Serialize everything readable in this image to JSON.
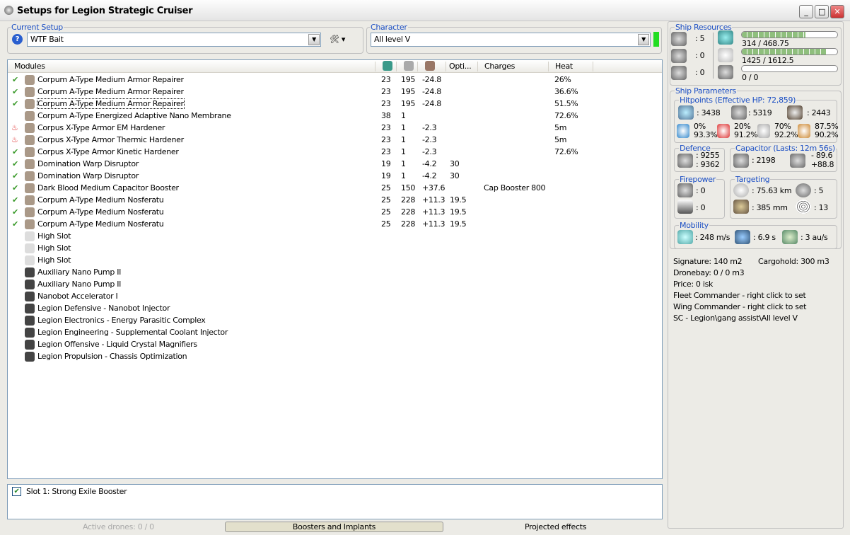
{
  "window": {
    "title": "Setups for Legion Strategic Cruiser",
    "min": "_",
    "max": "□",
    "close": "✕"
  },
  "setup": {
    "label": "Current Setup",
    "value": "WTF Bait",
    "help": "?"
  },
  "character": {
    "label": "Character",
    "value": "All level V",
    "status_color": "#22dd22"
  },
  "list": {
    "headers": [
      "Modules",
      "",
      "",
      "",
      "Opti...",
      "Charges",
      "Heat"
    ],
    "rows": [
      {
        "state": "check",
        "name": "Corpum A-Type Medium Armor Repairer",
        "cpu": "23",
        "pg": "195",
        "cap": "-24.8",
        "opt": "",
        "charges": "",
        "heat": "26%"
      },
      {
        "state": "check",
        "name": "Corpum A-Type Medium Armor Repairer",
        "cpu": "23",
        "pg": "195",
        "cap": "-24.8",
        "opt": "",
        "charges": "",
        "heat": "36.6%"
      },
      {
        "state": "check",
        "name": "Corpum A-Type Medium Armor Repairer",
        "cpu": "23",
        "pg": "195",
        "cap": "-24.8",
        "opt": "",
        "charges": "",
        "heat": "51.5%"
      },
      {
        "state": "none",
        "name": "Corpum A-Type Energized Adaptive Nano Membrane",
        "cpu": "38",
        "pg": "1",
        "cap": "",
        "opt": "",
        "charges": "",
        "heat": "72.6%"
      },
      {
        "state": "heat",
        "name": "Corpus X-Type Armor EM Hardener",
        "cpu": "23",
        "pg": "1",
        "cap": "-2.3",
        "opt": "",
        "charges": "",
        "heat": "5m"
      },
      {
        "state": "heat",
        "name": "Corpus X-Type Armor Thermic Hardener",
        "cpu": "23",
        "pg": "1",
        "cap": "-2.3",
        "opt": "",
        "charges": "",
        "heat": "5m"
      },
      {
        "state": "check",
        "name": "Corpus X-Type Armor Kinetic Hardener",
        "cpu": "23",
        "pg": "1",
        "cap": "-2.3",
        "opt": "",
        "charges": "",
        "heat": "72.6%"
      },
      {
        "state": "check",
        "name": "Domination Warp Disruptor",
        "cpu": "19",
        "pg": "1",
        "cap": "-4.2",
        "opt": "30",
        "charges": "",
        "heat": ""
      },
      {
        "state": "check",
        "name": "Domination Warp Disruptor",
        "cpu": "19",
        "pg": "1",
        "cap": "-4.2",
        "opt": "30",
        "charges": "",
        "heat": ""
      },
      {
        "state": "check",
        "name": "Dark Blood Medium Capacitor Booster",
        "cpu": "25",
        "pg": "150",
        "cap": "+37.6",
        "opt": "",
        "charges": "Cap Booster 800",
        "heat": ""
      },
      {
        "state": "check",
        "name": "Corpum A-Type Medium Nosferatu",
        "cpu": "25",
        "pg": "228",
        "cap": "+11.3",
        "opt": "19.5",
        "charges": "",
        "heat": ""
      },
      {
        "state": "check",
        "name": "Corpum A-Type Medium Nosferatu",
        "cpu": "25",
        "pg": "228",
        "cap": "+11.3",
        "opt": "19.5",
        "charges": "",
        "heat": ""
      },
      {
        "state": "check",
        "name": "Corpum A-Type Medium Nosferatu",
        "cpu": "25",
        "pg": "228",
        "cap": "+11.3",
        "opt": "19.5",
        "charges": "",
        "heat": ""
      },
      {
        "state": "none",
        "name": "High Slot",
        "cpu": "",
        "pg": "",
        "cap": "",
        "opt": "",
        "charges": "",
        "heat": ""
      },
      {
        "state": "none",
        "name": "High Slot",
        "cpu": "",
        "pg": "",
        "cap": "",
        "opt": "",
        "charges": "",
        "heat": ""
      },
      {
        "state": "none",
        "name": "High Slot",
        "cpu": "",
        "pg": "",
        "cap": "",
        "opt": "",
        "charges": "",
        "heat": ""
      },
      {
        "state": "none",
        "name": "Auxiliary Nano Pump II",
        "cpu": "",
        "pg": "",
        "cap": "",
        "opt": "",
        "charges": "",
        "heat": ""
      },
      {
        "state": "none",
        "name": "Auxiliary Nano Pump II",
        "cpu": "",
        "pg": "",
        "cap": "",
        "opt": "",
        "charges": "",
        "heat": ""
      },
      {
        "state": "none",
        "name": "Nanobot Accelerator I",
        "cpu": "",
        "pg": "",
        "cap": "",
        "opt": "",
        "charges": "",
        "heat": ""
      },
      {
        "state": "none",
        "name": "Legion Defensive - Nanobot Injector",
        "cpu": "",
        "pg": "",
        "cap": "",
        "opt": "",
        "charges": "",
        "heat": ""
      },
      {
        "state": "none",
        "name": "Legion Electronics - Energy Parasitic Complex",
        "cpu": "",
        "pg": "",
        "cap": "",
        "opt": "",
        "charges": "",
        "heat": ""
      },
      {
        "state": "none",
        "name": "Legion Engineering - Supplemental Coolant Injector",
        "cpu": "",
        "pg": "",
        "cap": "",
        "opt": "",
        "charges": "",
        "heat": ""
      },
      {
        "state": "none",
        "name": "Legion Offensive - Liquid Crystal Magnifiers",
        "cpu": "",
        "pg": "",
        "cap": "",
        "opt": "",
        "charges": "",
        "heat": ""
      },
      {
        "state": "none",
        "name": "Legion Propulsion - Chassis Optimization",
        "cpu": "",
        "pg": "",
        "cap": "",
        "opt": "",
        "charges": "",
        "heat": ""
      }
    ]
  },
  "boosters": {
    "item": "Slot 1: Strong Exile Booster"
  },
  "tabs": {
    "drones": "Active drones: 0 / 0",
    "boosters": "Boosters and Implants",
    "projected": "Projected effects"
  },
  "resources": {
    "label": "Ship Resources",
    "turrets": ": 5",
    "launchers": ": 0",
    "rigs": ": 0",
    "cpu": "314 / 468.75",
    "cpu_frac": 0.67,
    "pg": "1425 / 1612.5",
    "pg_frac": 0.88,
    "calib": "0 / 0",
    "calib_frac": 0
  },
  "params": {
    "label": "Ship Parameters",
    "hp": {
      "label": "Hitpoints (Effective HP: 72,859)",
      "shield": ": 3438",
      "armor": ": 5319",
      "hull": ": 2443",
      "res": [
        [
          "0%",
          "93.3%"
        ],
        [
          "20%",
          "91.2%"
        ],
        [
          "70%",
          "92.2%"
        ],
        [
          "87.5%",
          "90.2%"
        ]
      ]
    },
    "defence": {
      "label": "Defence",
      "a": ": 9255",
      "b": ": 9362"
    },
    "capacitor": {
      "label": "Capacitor (Lasts: 12m 56s)",
      "cap": ": 2198",
      "use": "- 89.6",
      "regen": "+88.8"
    },
    "firepower": {
      "label": "Firepower",
      "a": ": 0",
      "b": ": 0"
    },
    "targeting": {
      "label": "Targeting",
      "range": ": 75.63 km",
      "targets": ": 5",
      "res": ": 385 mm",
      "sensor": ": 13"
    },
    "mobility": {
      "label": "Mobility",
      "speed": ": 248 m/s",
      "align": ": 6.9 s",
      "warp": ": 3 au/s"
    }
  },
  "info": {
    "signature": "Signature: 140 m2",
    "cargo": "Cargohold: 300 m3",
    "dronebay": "Dronebay: 0 / 0 m3",
    "price": "Price: 0 isk",
    "fleet": "Fleet Commander - right click to set",
    "wing": "Wing Commander - right click to set",
    "sc": "SC - Legion\\gang assist\\All level V"
  }
}
